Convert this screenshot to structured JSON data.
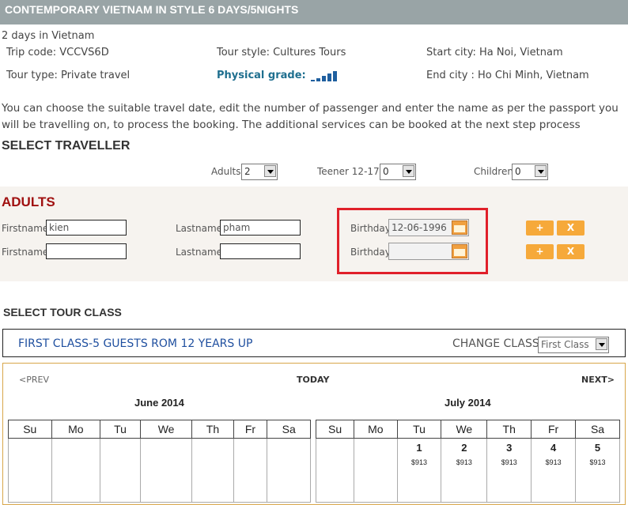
{
  "header": {
    "title": "CONTEMPORARY VIETNAM IN STYLE 6 DAYS/5NIGHTS"
  },
  "tour": {
    "duration": "2 days in Vietnam",
    "trip_code": "Trip code: VCCVS6D",
    "tour_style": "Tour style: Cultures Tours",
    "start_city": "Start city: Ha Noi, Vietnam",
    "tour_type": "Tour type: Private travel",
    "physical_grade_label": "Physical grade:",
    "physical_grade_level": 5,
    "end_city": "End city : Ho Chi Minh, Vietnam"
  },
  "intro_text": "You can choose the suitable travel date, edit the number of passenger and enter the name as per the passport you will be travelling on, to process the booking. The additional services can be booked at the next step process",
  "traveller": {
    "heading": "SELECT TRAVELLER",
    "adults_label": "Adults",
    "adults_value": "2",
    "teener_label": "Teener 12-17",
    "teener_value": "0",
    "children_label": "Children",
    "children_value": "0"
  },
  "adults": {
    "heading": "ADULTS",
    "firstname_label": "Firstname",
    "lastname_label": "Lastname",
    "birthday_label": "Birthday",
    "rows": [
      {
        "firstname": "kien",
        "lastname": "pham",
        "birthday": "12-06-1996"
      },
      {
        "firstname": "",
        "lastname": "",
        "birthday": ""
      }
    ],
    "add_label": "+",
    "remove_label": "X"
  },
  "tour_class": {
    "heading": "SELECT TOUR CLASS",
    "selected_class": "FIRST CLASS-5 GUESTS ROM 12 YEARS UP",
    "change_label": "CHANGE CLASS",
    "change_value": "First Class"
  },
  "calendar": {
    "prev_label": "<PREV",
    "today_label": "TODAY",
    "next_label": "NEXT>",
    "weekdays": [
      "Su",
      "Mo",
      "Tu",
      "We",
      "Th",
      "Fr",
      "Sa"
    ],
    "months": [
      {
        "name": "June 2014",
        "days": []
      },
      {
        "name": "July 2014",
        "days": [
          {
            "day": "1",
            "price": "$913"
          },
          {
            "day": "2",
            "price": "$913"
          },
          {
            "day": "3",
            "price": "$913"
          },
          {
            "day": "4",
            "price": "$913"
          },
          {
            "day": "5",
            "price": "$913"
          }
        ]
      }
    ]
  },
  "colors": {
    "title_bar": "#99a4a6",
    "accent_red": "#a01010",
    "button_orange": "#f6a93a",
    "link_blue": "#1f4f9f"
  }
}
